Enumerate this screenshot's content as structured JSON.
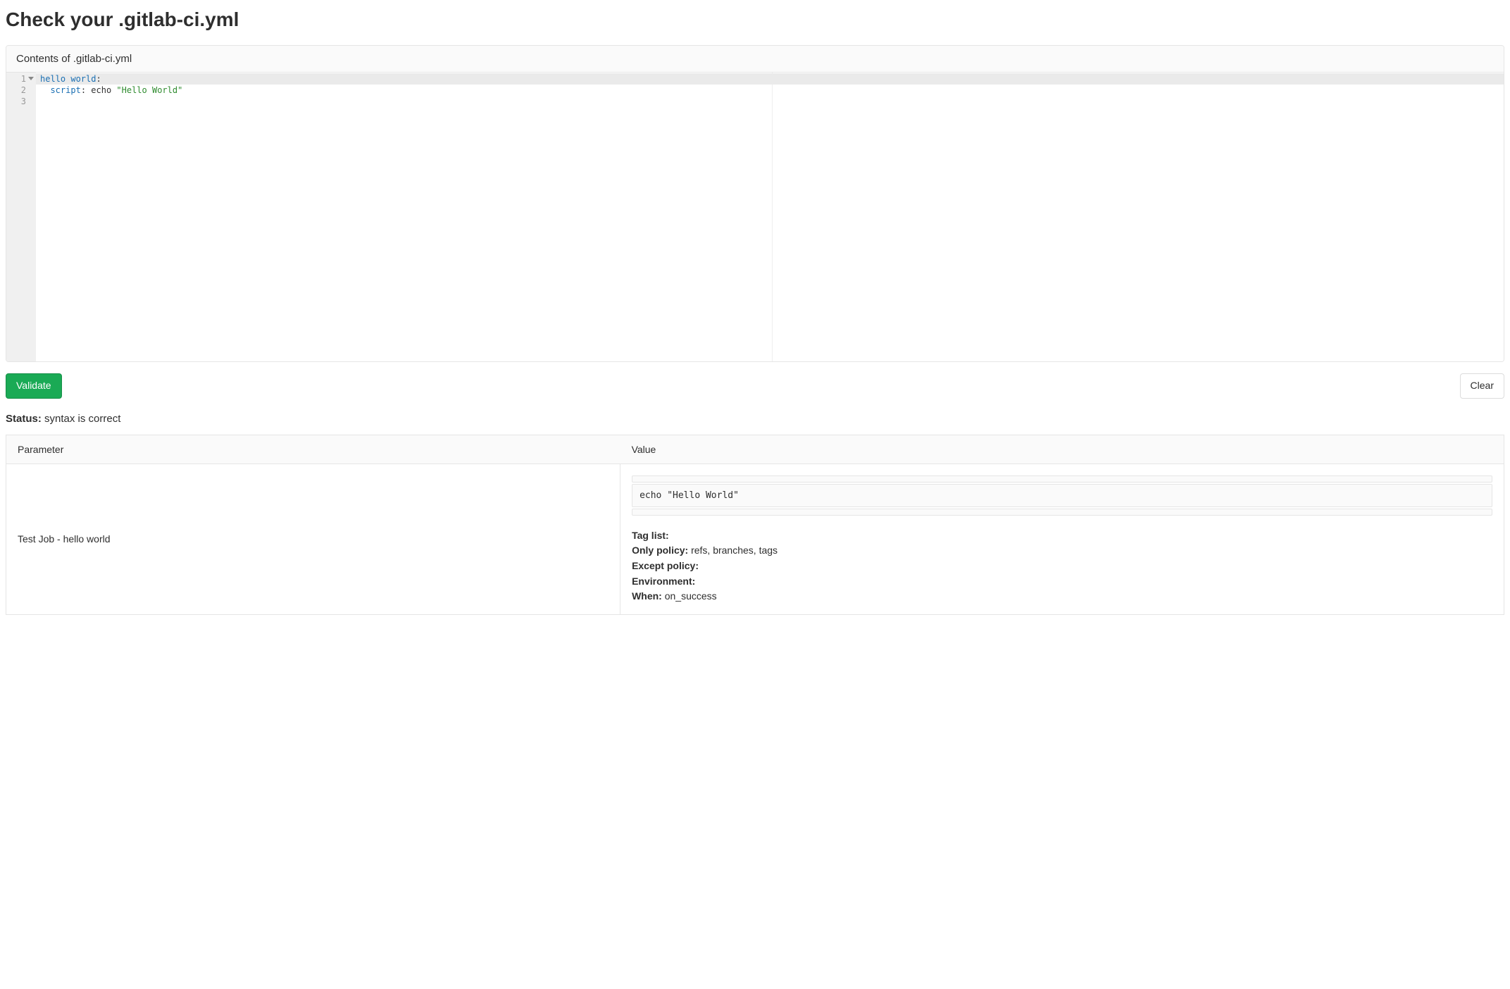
{
  "page": {
    "title": "Check your .gitlab-ci.yml"
  },
  "editor": {
    "header": "Contents of .gitlab-ci.yml",
    "lines": [
      {
        "num": "1",
        "fold": true,
        "segments": [
          {
            "t": "hello world",
            "c": "tok-key"
          },
          {
            "t": ":",
            "c": "tok-punc"
          }
        ],
        "active": true
      },
      {
        "num": "2",
        "fold": false,
        "segments": [
          {
            "t": "  ",
            "c": "tok-plain"
          },
          {
            "t": "script",
            "c": "tok-key"
          },
          {
            "t": ": ",
            "c": "tok-punc"
          },
          {
            "t": "echo ",
            "c": "tok-plain"
          },
          {
            "t": "\"Hello World\"",
            "c": "tok-str"
          }
        ],
        "active": false
      },
      {
        "num": "3",
        "fold": false,
        "segments": [],
        "active": false
      }
    ]
  },
  "actions": {
    "validate_label": "Validate",
    "clear_label": "Clear"
  },
  "status": {
    "label": "Status:",
    "value": "syntax is correct"
  },
  "table": {
    "col_parameter": "Parameter",
    "col_value": "Value",
    "row": {
      "parameter": "Test Job - hello world",
      "pre_blocks": [
        "",
        "echo \"Hello World\"",
        ""
      ],
      "meta": {
        "tag_list_label": "Tag list:",
        "tag_list_value": "",
        "only_policy_label": "Only policy:",
        "only_policy_value": "refs, branches, tags",
        "except_policy_label": "Except policy:",
        "except_policy_value": "",
        "environment_label": "Environment:",
        "environment_value": "",
        "when_label": "When:",
        "when_value": "on_success"
      }
    }
  }
}
